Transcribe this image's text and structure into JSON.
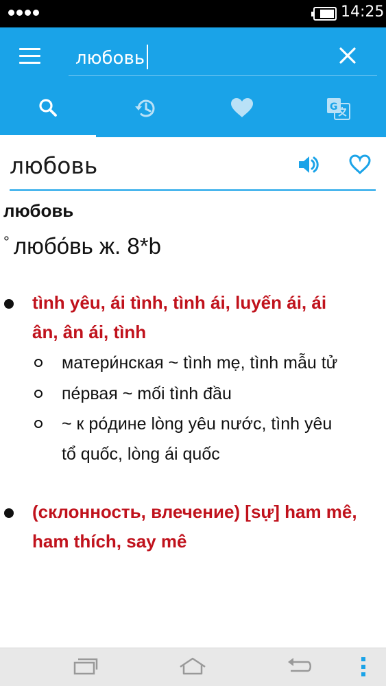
{
  "status_bar": {
    "time": "14:25"
  },
  "search": {
    "value": "любовь"
  },
  "tabs": [
    {
      "name": "search",
      "icon": "search-icon"
    },
    {
      "name": "history",
      "icon": "history-icon"
    },
    {
      "name": "favorites",
      "icon": "heart-icon"
    },
    {
      "name": "translate",
      "icon": "google-translate-icon"
    }
  ],
  "header": {
    "word": "любовь"
  },
  "entry": {
    "title": "любовь",
    "pronunciation_mark": "°",
    "pronunciation": "любо́вь ж. 8*b",
    "meanings": [
      {
        "text_line1": "tình yêu, ái tình, tình ái, luyến ái, ái",
        "text_line2": "ân, ân ái, tình",
        "examples": [
          {
            "text": "матери́нская ~ tình mẹ, tình mẫu tử"
          },
          {
            "text": "пе́рвая ~ mối tình đầu"
          },
          {
            "text_line1": "~ к ро́дине lòng yêu nước, tình yêu",
            "text_line2": "tổ quốc, lòng ái quốc"
          }
        ]
      },
      {
        "text_line1": "(склонность, влечение) [sự] ham mê,",
        "text_line2": "ham thích, say mê"
      }
    ]
  },
  "colors": {
    "accent": "#1aa3e8",
    "meaning": "#c0121c"
  }
}
